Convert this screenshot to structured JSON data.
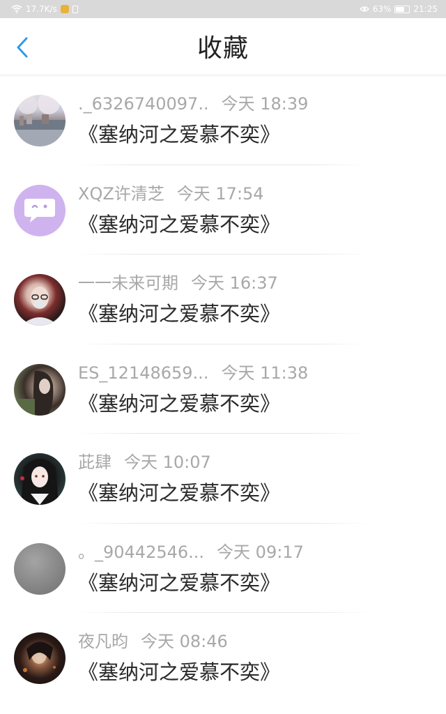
{
  "status_bar": {
    "net_speed": "17.7K/s",
    "battery_percent": "63%",
    "time": "21:25"
  },
  "header": {
    "title": "收藏"
  },
  "items": [
    {
      "username": "._6326740097..",
      "time": "今天 18:39",
      "content": "《塞纳河之爱慕不奕》"
    },
    {
      "username": "XQZ许清芝",
      "time": "今天 17:54",
      "content": "《塞纳河之爱慕不奕》"
    },
    {
      "username": "一一未来可期",
      "time": "今天 16:37",
      "content": "《塞纳河之爱慕不奕》"
    },
    {
      "username": "ES_12148659...",
      "time": "今天 11:38",
      "content": "《塞纳河之爱慕不奕》"
    },
    {
      "username": "茈肆",
      "time": "今天 10:07",
      "content": "《塞纳河之爱慕不奕》"
    },
    {
      "username": "。_90442546...",
      "time": "今天 09:17",
      "content": "《塞纳河之爱慕不奕》"
    },
    {
      "username": "夜凡昀",
      "time": "今天 08:46",
      "content": "《塞纳河之爱慕不奕》"
    }
  ]
}
